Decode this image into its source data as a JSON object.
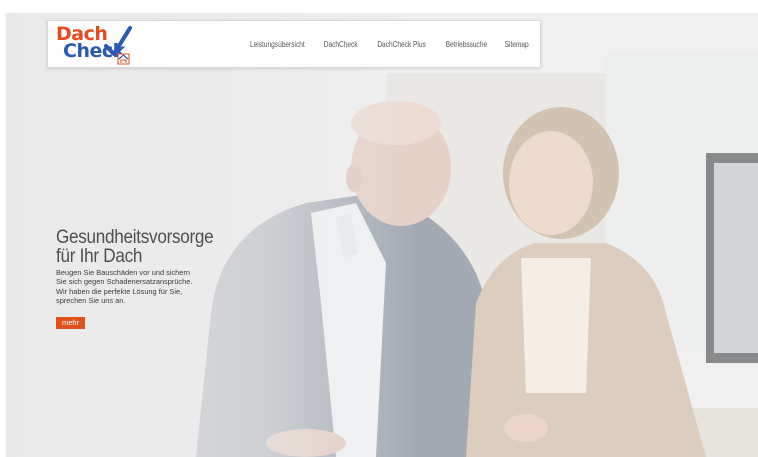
{
  "logo": {
    "line1": "Dach",
    "line2": "Check"
  },
  "nav": {
    "items": [
      {
        "label": "Leistungsübersicht"
      },
      {
        "label": "DachCheck"
      },
      {
        "label": "DachCheck Plus"
      },
      {
        "label": "Betriebssuche"
      },
      {
        "label": "Sitemap"
      }
    ]
  },
  "hero": {
    "headline_line1": "Gesundheitsvorsorge",
    "headline_line2": "für Ihr Dach",
    "text_lines": [
      "Beugen Sie Bauschäden vor und sichern",
      "Sie sich gegen Schadenersatzansprüche.",
      "Wir haben die perfekte Lösung für Sie,",
      "sprechen Sie uns an."
    ],
    "more_label": "mehr"
  },
  "colors": {
    "accent_orange": "#e2501f",
    "logo_blue": "#2b58b0",
    "logo_orange": "#e64b1e"
  },
  "icons": {
    "logo_mark": "roof-checkmark-icon",
    "logo_badge": "house-badge-icon"
  }
}
